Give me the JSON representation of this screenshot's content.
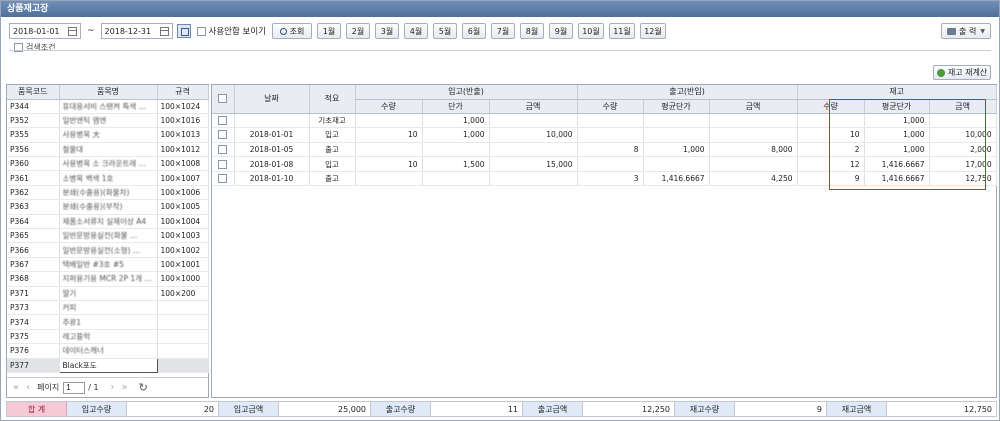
{
  "window": {
    "title": "상품재고장"
  },
  "toolbar": {
    "date_from": "2018-01-01",
    "tilde": "~",
    "date_to": "2018-12-31",
    "show_unused_label": "사용안함 보이기",
    "search_label": "조회",
    "months": [
      "1월",
      "2월",
      "3월",
      "4월",
      "5월",
      "6월",
      "7월",
      "8월",
      "9월",
      "10월",
      "11월",
      "12월"
    ],
    "print_label": "출 력"
  },
  "search_condition_label": "검색조건",
  "recalc_label": "재고 재계산",
  "left": {
    "headers": [
      "품목코드",
      "품목명",
      "규격"
    ],
    "rows": [
      {
        "code": "P344",
        "name": "휴대용서비 스탠켜 특색 …",
        "spec": "100×1024",
        "blur": true
      },
      {
        "code": "P352",
        "name": "일반앤틱 엠엔",
        "spec": "100×1016",
        "blur": true
      },
      {
        "code": "P355",
        "name": "사용병목 大",
        "spec": "100×1013",
        "blur": true
      },
      {
        "code": "P356",
        "name": "철물대",
        "spec": "100×1012",
        "blur": true
      },
      {
        "code": "P360",
        "name": "사용병목 소 크라운트레 …",
        "spec": "100×1008",
        "blur": true
      },
      {
        "code": "P361",
        "name": "소병목 백색 1호",
        "spec": "100×1007",
        "blur": true
      },
      {
        "code": "P362",
        "name": "분쇄(수출용)(화물차)",
        "spec": "100×1006",
        "blur": true
      },
      {
        "code": "P363",
        "name": "분쇄(수출용)(부착)",
        "spec": "100×1005",
        "blur": true
      },
      {
        "code": "P364",
        "name": "제품소서류지 실제이상 A4",
        "spec": "100×1004",
        "blur": true
      },
      {
        "code": "P365",
        "name": "일반문방용실전(화물 …",
        "spec": "100×1003",
        "blur": true
      },
      {
        "code": "P366",
        "name": "일반문방용실전(소형) …",
        "spec": "100×1002",
        "blur": true
      },
      {
        "code": "P367",
        "name": "택배일반 #3호 #5",
        "spec": "100×1001",
        "blur": true
      },
      {
        "code": "P368",
        "name": "지퍼용기용 MCR 2P 1개 …",
        "spec": "100×1000",
        "blur": true
      },
      {
        "code": "P371",
        "name": "딸기",
        "spec": "100×200",
        "blur": true
      },
      {
        "code": "P373",
        "name": "커피",
        "spec": "",
        "blur": true
      },
      {
        "code": "P374",
        "name": "주류1",
        "spec": "",
        "blur": true
      },
      {
        "code": "P375",
        "name": "레고블럭",
        "spec": "",
        "blur": true
      },
      {
        "code": "P376",
        "name": "데이터스캐너",
        "spec": "",
        "blur": true
      },
      {
        "code": "P377",
        "name": "Black포도",
        "spec": "",
        "blur": false,
        "selected": true
      }
    ],
    "pager": {
      "first": "«",
      "prev": "‹",
      "page_label": "페이지",
      "page": "1",
      "total": "/ 1",
      "next": "›",
      "last": "»",
      "refresh": "↻"
    }
  },
  "right": {
    "group_headers": {
      "date": "날짜",
      "desc": "적요",
      "in": "입고(반출)",
      "out": "출고(반입)",
      "stock": "재고"
    },
    "sub_headers": {
      "qty": "수량",
      "unit": "단가",
      "amount": "금액",
      "avg_unit": "평균단가"
    },
    "rows": [
      {
        "date": "",
        "desc": "기초재고",
        "in_qty": "",
        "in_unit": "1,000",
        "in_amt": "",
        "out_qty": "",
        "out_avg": "",
        "out_amt": "",
        "st_qty": "",
        "st_avg": "1,000",
        "st_amt": ""
      },
      {
        "date": "2018-01-01",
        "desc": "입고",
        "in_qty": "10",
        "in_unit": "1,000",
        "in_amt": "10,000",
        "out_qty": "",
        "out_avg": "",
        "out_amt": "",
        "st_qty": "10",
        "st_avg": "1,000",
        "st_amt": "10,000"
      },
      {
        "date": "2018-01-05",
        "desc": "출고",
        "in_qty": "",
        "in_unit": "",
        "in_amt": "",
        "out_qty": "8",
        "out_avg": "1,000",
        "out_amt": "8,000",
        "st_qty": "2",
        "st_avg": "1,000",
        "st_amt": "2,000"
      },
      {
        "date": "2018-01-08",
        "desc": "입고",
        "in_qty": "10",
        "in_unit": "1,500",
        "in_amt": "15,000",
        "out_qty": "",
        "out_avg": "",
        "out_amt": "",
        "st_qty": "12",
        "st_avg": "1,416.6667",
        "st_amt": "17,000"
      },
      {
        "date": "2018-01-10",
        "desc": "출고",
        "in_qty": "",
        "in_unit": "",
        "in_amt": "",
        "out_qty": "3",
        "out_avg": "1,416.6667",
        "out_amt": "4,250",
        "st_qty": "9",
        "st_avg": "1,416.6667",
        "st_amt": "12,750"
      }
    ],
    "highlight_color": "#e0242b"
  },
  "totals": {
    "header": "합 계",
    "in_qty_label": "입고수량",
    "in_qty": "20",
    "in_amt_label": "입고금액",
    "in_amt": "25,000",
    "out_qty_label": "출고수량",
    "out_qty": "11",
    "out_amt_label": "출고금액",
    "out_amt": "12,250",
    "st_qty_label": "재고수량",
    "st_qty": "9",
    "st_amt_label": "재고금액",
    "st_amt": "12,750"
  }
}
